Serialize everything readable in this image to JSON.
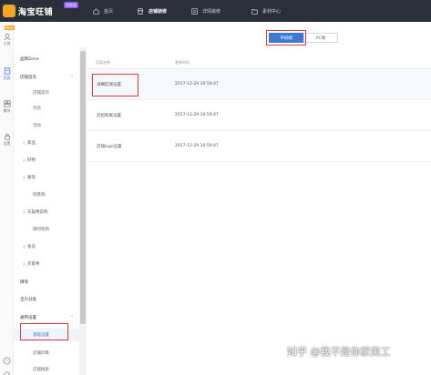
{
  "app": {
    "logo_text": "淘宝旺铺",
    "logo_badge": "智能版"
  },
  "topnav": [
    {
      "label": "首页",
      "icon": "home-icon"
    },
    {
      "label": "店铺装修",
      "icon": "shop-icon"
    },
    {
      "label": "详情装修",
      "icon": "detail-icon"
    },
    {
      "label": "素材中心",
      "icon": "folder-icon"
    }
  ],
  "rail": {
    "tag": "New",
    "items": [
      {
        "label": "大屏",
        "icon": "avatar-icon"
      },
      {
        "label": "页面",
        "icon": "page-icon"
      },
      {
        "label": "模块",
        "icon": "module-icon"
      },
      {
        "label": "设置",
        "icon": "lock-icon"
      }
    ]
  },
  "submenu": {
    "items": [
      {
        "label": "品牌Zone",
        "kind": "group"
      },
      {
        "label": "店铺首页",
        "kind": "group",
        "caret": "^"
      },
      {
        "label": "店铺首页",
        "kind": "sub"
      },
      {
        "label": "包装",
        "kind": "sub"
      },
      {
        "label": "活动",
        "kind": "sub"
      },
      {
        "label": "新品",
        "kind": "cat",
        "tag": "A"
      },
      {
        "label": "好物",
        "kind": "cat",
        "tag": "A"
      },
      {
        "label": "服饰",
        "kind": "cat",
        "tag": "A"
      },
      {
        "label": "场景购",
        "kind": "sub"
      },
      {
        "label": "天猫特卖购",
        "kind": "cat",
        "tag": "A"
      },
      {
        "label": "限时抢购",
        "kind": "sub"
      },
      {
        "label": "会员",
        "kind": "cat",
        "tag": "A"
      },
      {
        "label": "买家秀",
        "kind": "cat",
        "tag": "A"
      },
      {
        "label": "微淘",
        "kind": "group"
      },
      {
        "label": "宝贝分类",
        "kind": "group"
      },
      {
        "label": "通用设置",
        "kind": "group",
        "caret": "^"
      },
      {
        "label": "基础设置",
        "kind": "sub",
        "active": true
      },
      {
        "label": "店铺印象",
        "kind": "sub"
      },
      {
        "label": "店铺搜索",
        "kind": "sub"
      }
    ]
  },
  "tabs": [
    {
      "label": "手机端",
      "active": true
    },
    {
      "label": "PC端",
      "active": false
    }
  ],
  "table": {
    "headers": [
      "页面名称",
      "更新时间"
    ],
    "rows": [
      {
        "name": "详细区域设置",
        "time": "2017-12-29 10:59:47"
      },
      {
        "name": "店招和尾设置",
        "time": "2017-12-29 10:59:47"
      },
      {
        "name": "店铺logo设置",
        "time": "2017-12-29 10:59:47"
      }
    ]
  },
  "watermark": "知乎 @我不是你家美工",
  "colors": {
    "topbar": "#2b2f3a",
    "accent": "#3a7bd5",
    "highlight": "#e53935",
    "brand": "#f6a623"
  }
}
